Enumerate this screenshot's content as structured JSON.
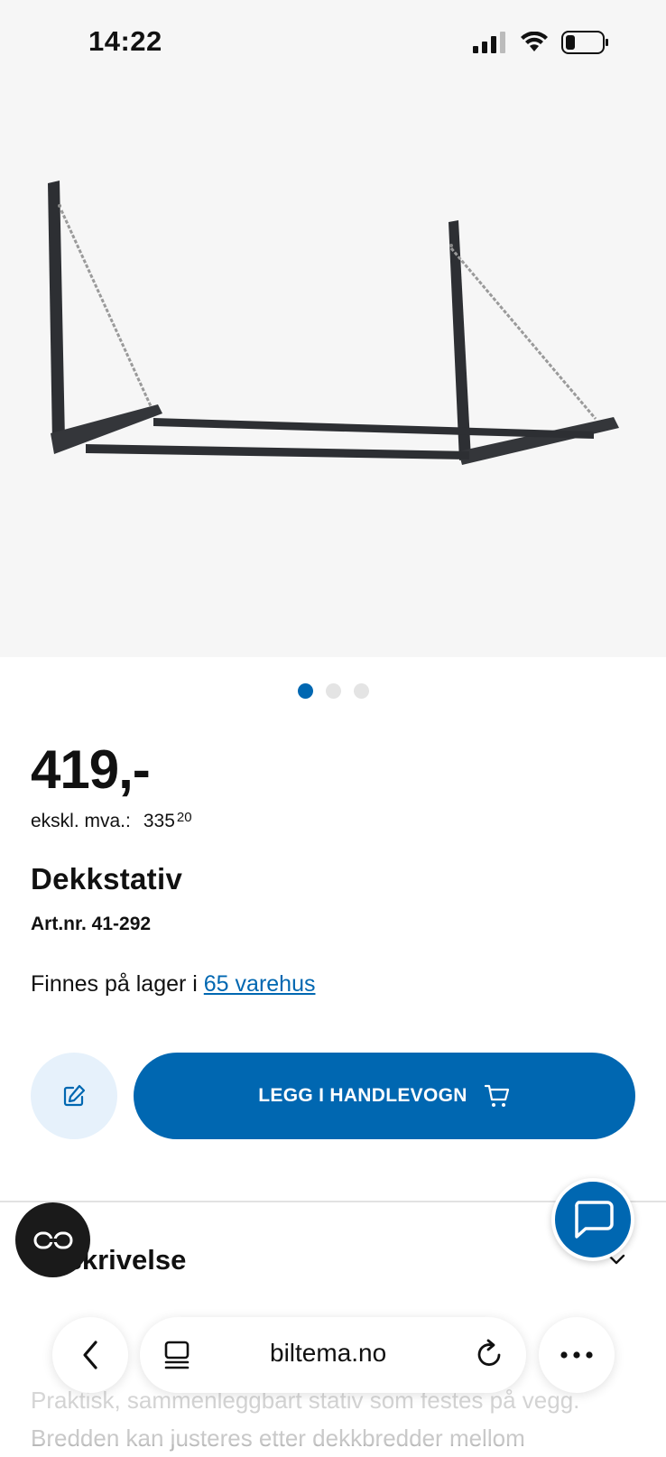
{
  "status_bar": {
    "time": "14:22"
  },
  "carousel": {
    "total": 3,
    "active": 1
  },
  "product": {
    "price": "419,-",
    "vat_label": "ekskl. mva.:",
    "vat_main": "335",
    "vat_cents": "20",
    "name": "Dekkstativ",
    "art_nr": "Art.nr. 41-292",
    "stock_prefix": "Finnes på lager i",
    "stock_link": "65 varehus"
  },
  "actions": {
    "add_to_cart_label": "LEGG I HANDLEVOGN"
  },
  "description": {
    "title": "Beskrivelse",
    "text": "Praktisk, sammenleggbart stativ som festes på vegg. Bredden kan justeres etter dekkbredder mellom"
  },
  "browser": {
    "url": "biltema.no"
  },
  "colors": {
    "brand_blue": "#0067b1",
    "light_blue": "#e6f1fb"
  },
  "icons": [
    "signal-icon",
    "wifi-icon",
    "battery-icon",
    "edit-icon",
    "cart-icon",
    "chevron-down-icon",
    "reader-icon",
    "chat-icon",
    "back-icon",
    "tabs-icon",
    "reload-icon",
    "more-icon"
  ]
}
